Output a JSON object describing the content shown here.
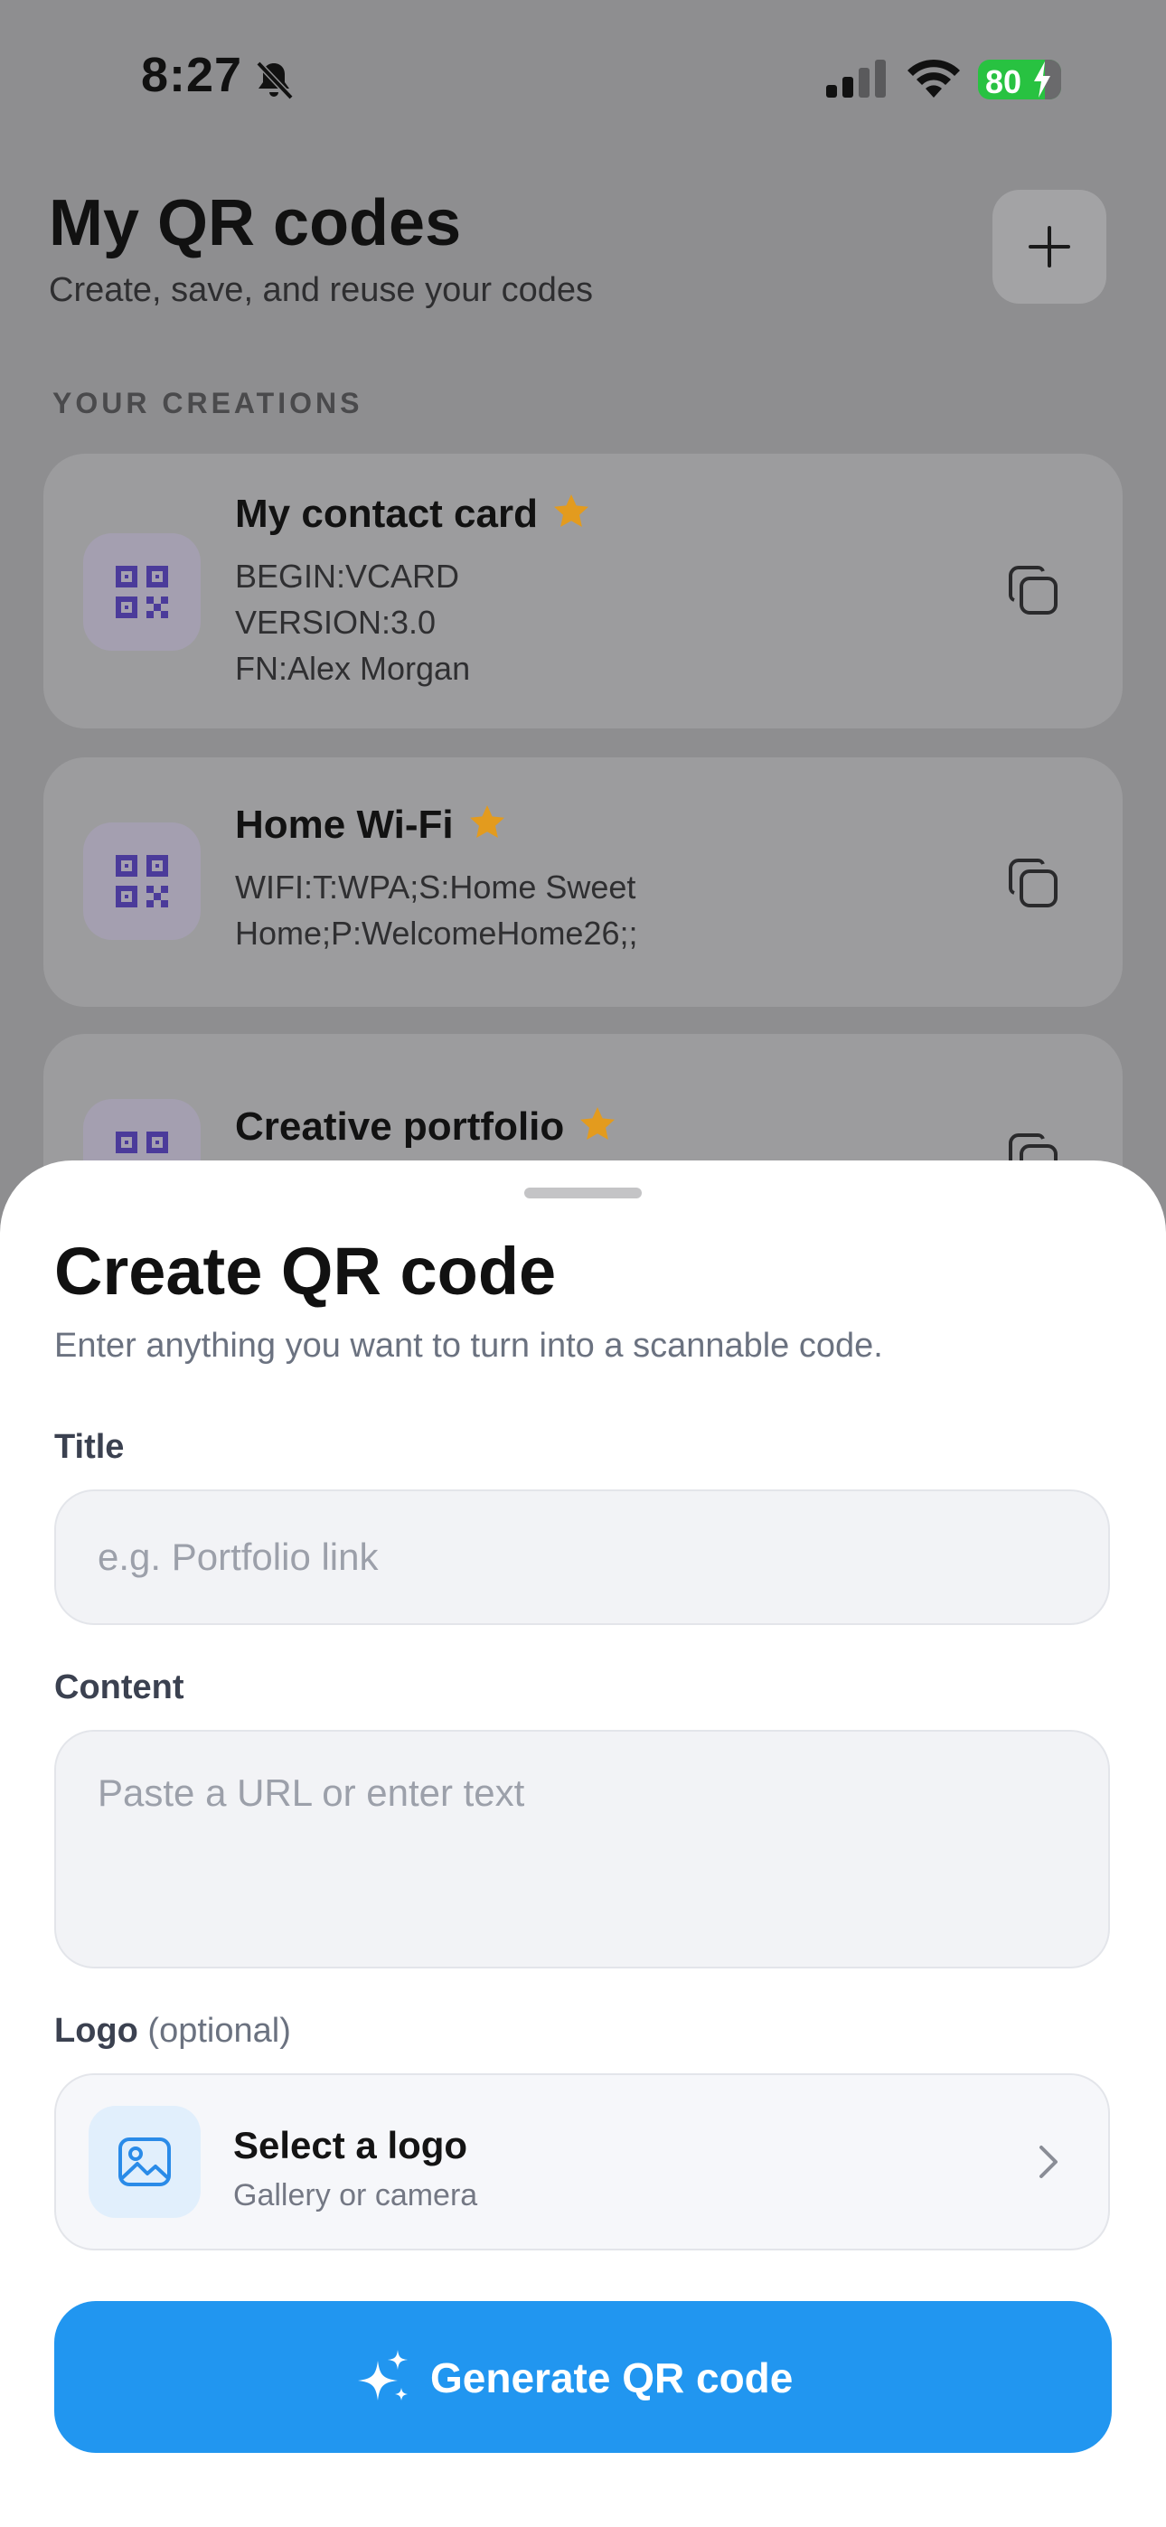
{
  "status_bar": {
    "time": "8:27",
    "battery": "80",
    "icons": [
      "bell-slash-icon",
      "signal-icon",
      "wifi-icon",
      "battery-charging-icon"
    ]
  },
  "header": {
    "title": "My QR codes",
    "subtitle": "Create, save, and reuse your codes",
    "add_icon": "plus-icon"
  },
  "section": {
    "label": "YOUR CREATIONS"
  },
  "cards": [
    {
      "title": "My contact card",
      "content": "BEGIN:VCARD\nVERSION:3.0\nFN:Alex Morgan",
      "favorite": true
    },
    {
      "title": "Home Wi-Fi",
      "content": "WIFI:T:WPA;S:Home Sweet\nHome;P:WelcomeHome26;;",
      "favorite": true
    },
    {
      "title": "Creative portfolio",
      "content": "",
      "favorite": true
    }
  ],
  "sheet": {
    "title": "Create QR code",
    "subtitle": "Enter anything you want to turn into a scannable code.",
    "title_field": {
      "label": "Title",
      "value": "",
      "placeholder": "e.g. Portfolio link"
    },
    "content_field": {
      "label": "Content",
      "value": "",
      "placeholder": "Paste a URL or enter text"
    },
    "logo_field": {
      "label": "Logo",
      "optional": "(optional)",
      "picker_title": "Select a logo",
      "picker_subtitle": "Gallery or camera"
    },
    "generate_label": "Generate QR code"
  },
  "colors": {
    "accent": "#2196F0",
    "star": "#E39B1E",
    "qr_icon": "#4B3B9A",
    "battery": "#28C241"
  }
}
